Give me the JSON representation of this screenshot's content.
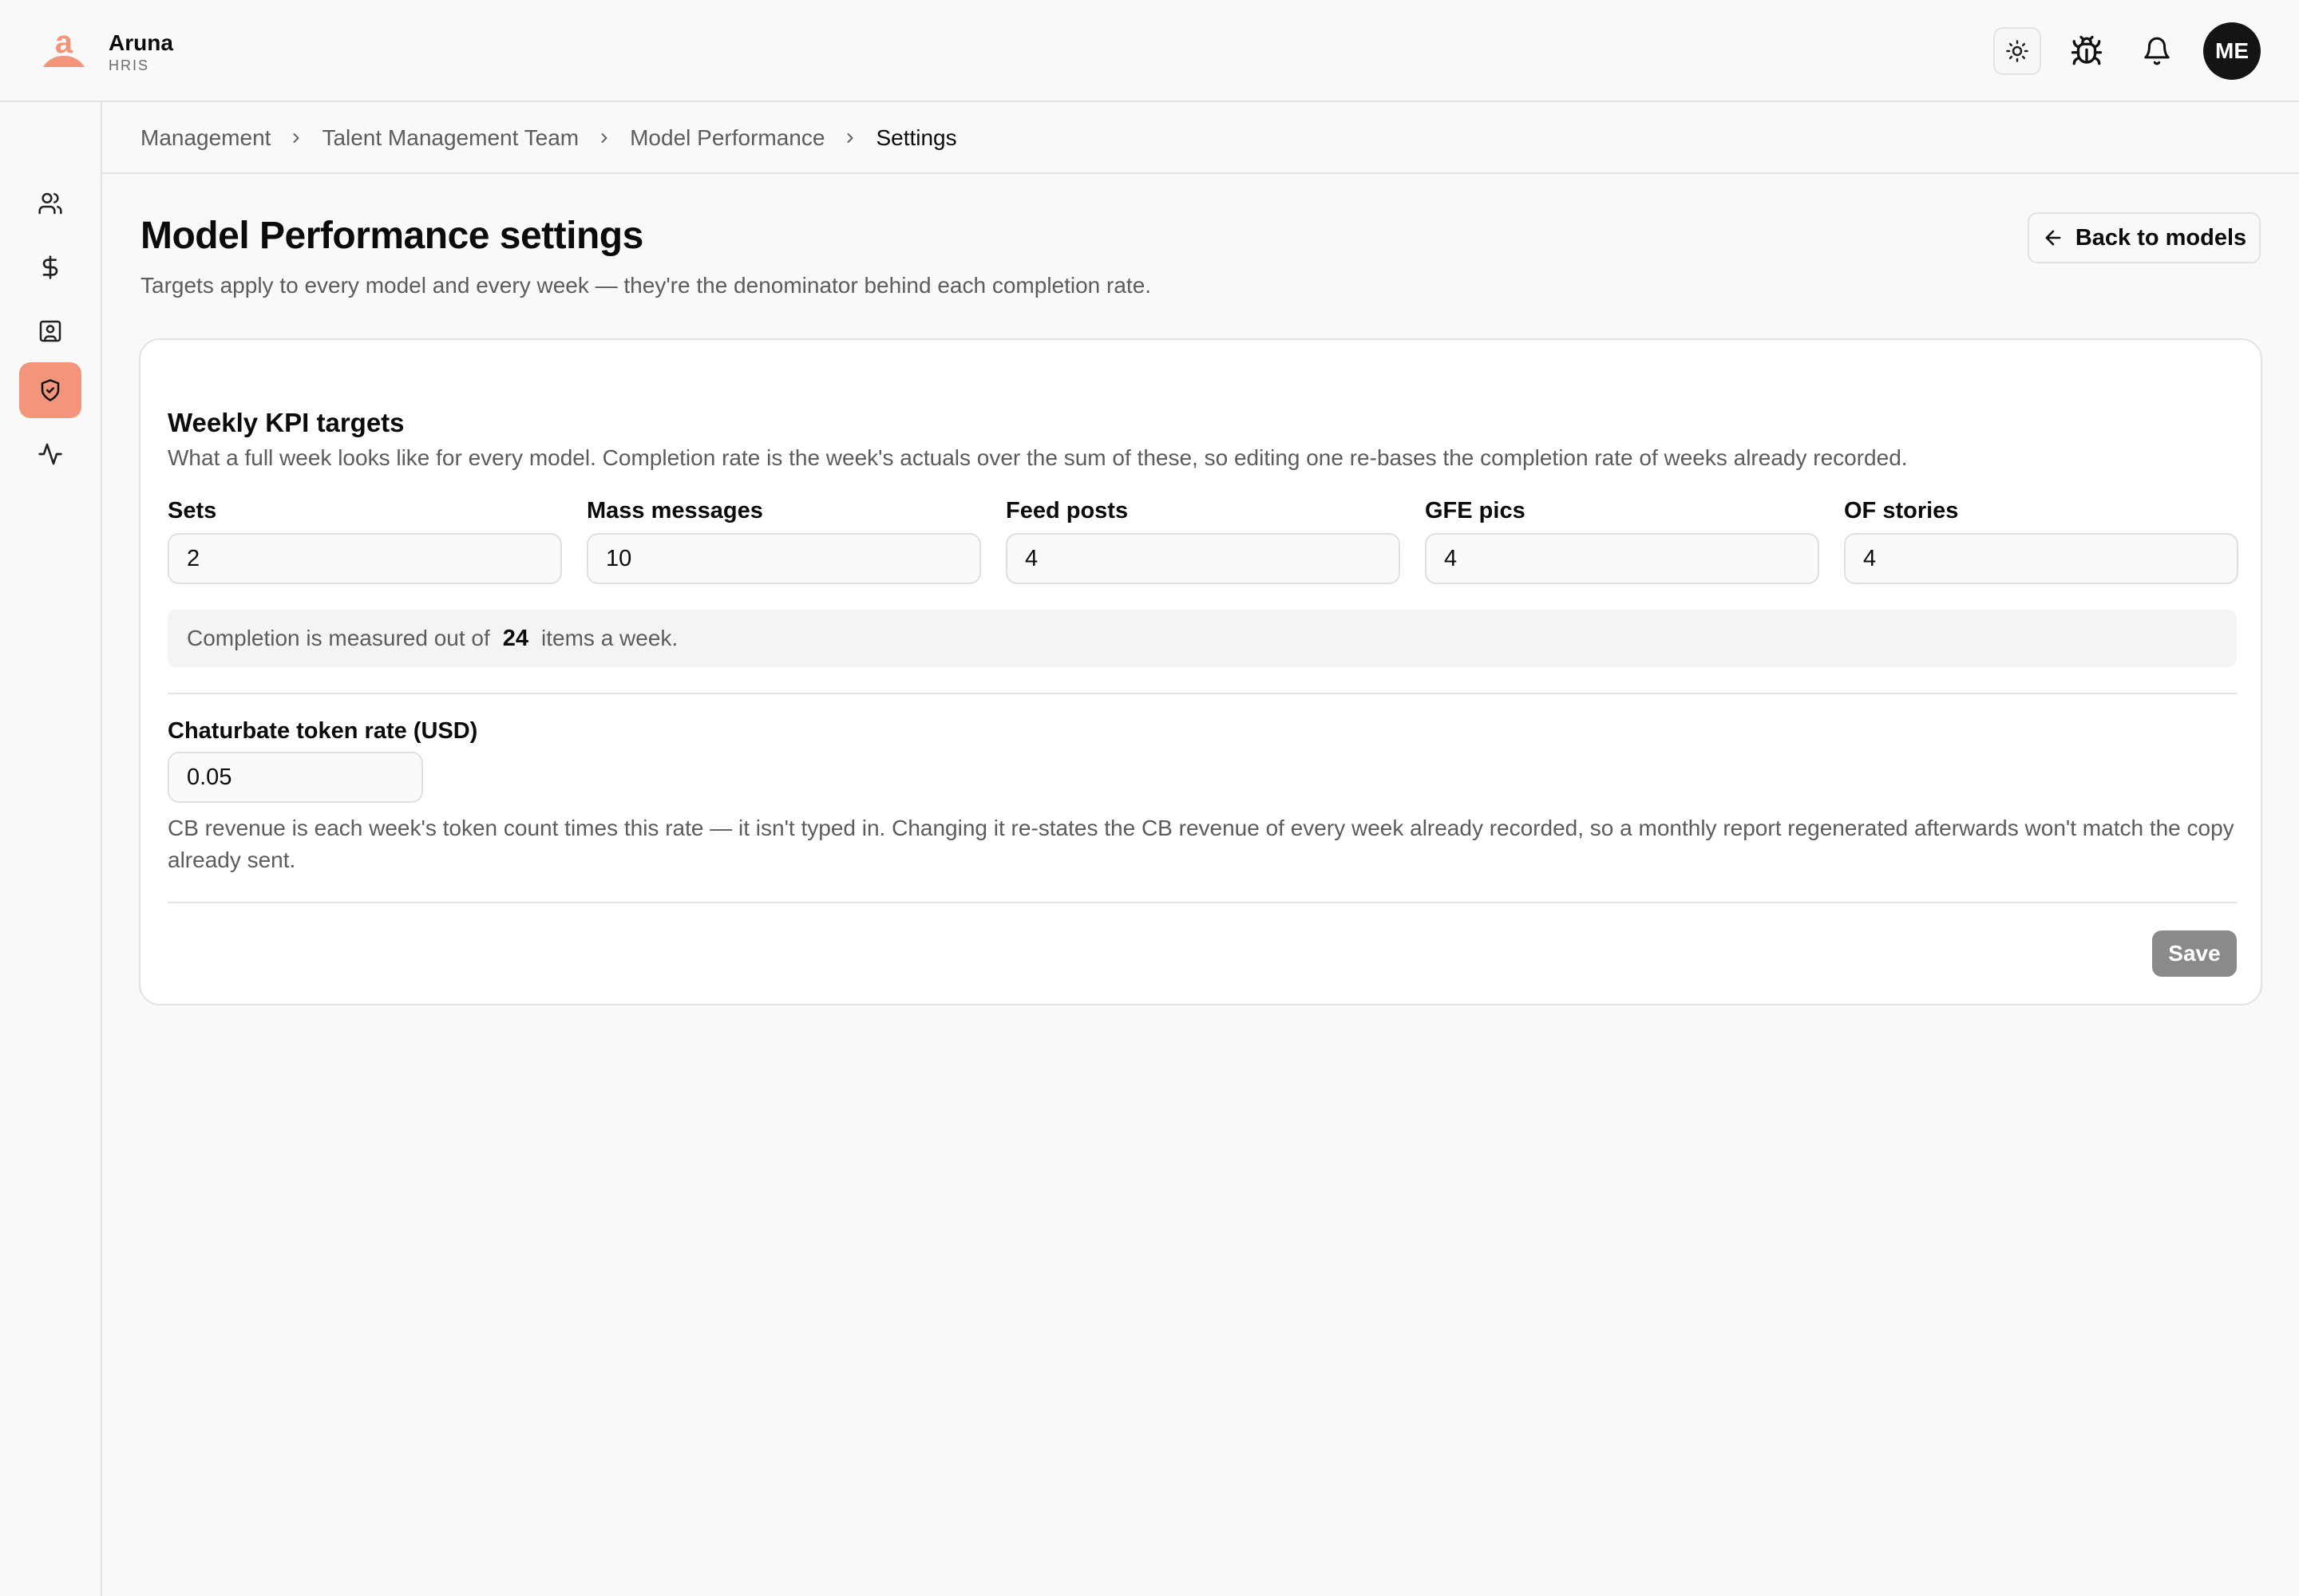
{
  "brand": {
    "name": "Aruna",
    "sub": "HRIS",
    "logo_icon": "aruna-a-logo",
    "accent": "#f2957a"
  },
  "header": {
    "theme_icon": "sun-icon",
    "bug_icon": "bug-icon",
    "bell_icon": "bell-icon",
    "avatar_initials": "ME"
  },
  "sidebar": {
    "items": [
      {
        "icon": "users-icon",
        "active": false
      },
      {
        "icon": "dollar-icon",
        "active": false
      },
      {
        "icon": "contact-card-icon",
        "active": false
      },
      {
        "icon": "shield-check-icon",
        "active": true
      },
      {
        "icon": "activity-icon",
        "active": false
      }
    ]
  },
  "breadcrumb": [
    "Management",
    "Talent Management Team",
    "Model Performance",
    "Settings"
  ],
  "page": {
    "title": "Model Performance settings",
    "subtitle": "Targets apply to every model and every week — they're the denominator behind each completion rate.",
    "back_label": "Back to models"
  },
  "kpi": {
    "title": "Weekly KPI targets",
    "description": "What a full week looks like for every model. Completion rate is the week's actuals over the sum of these, so editing one re-bases the completion rate of weeks already recorded.",
    "fields": [
      {
        "label": "Sets",
        "value": "2"
      },
      {
        "label": "Mass messages",
        "value": "10"
      },
      {
        "label": "Feed posts",
        "value": "4"
      },
      {
        "label": "GFE pics",
        "value": "4"
      },
      {
        "label": "OF stories",
        "value": "4"
      }
    ],
    "total_prefix": "Completion is measured out of",
    "total_value": "24",
    "total_suffix": "items a week."
  },
  "rate": {
    "label": "Chaturbate token rate (USD)",
    "value": "0.05",
    "description": "CB revenue is each week's token count times this rate — it isn't typed in. Changing it re-states the CB revenue of every week already recorded, so a monthly report regenerated afterwards won't match the copy already sent."
  },
  "actions": {
    "save_label": "Save"
  }
}
